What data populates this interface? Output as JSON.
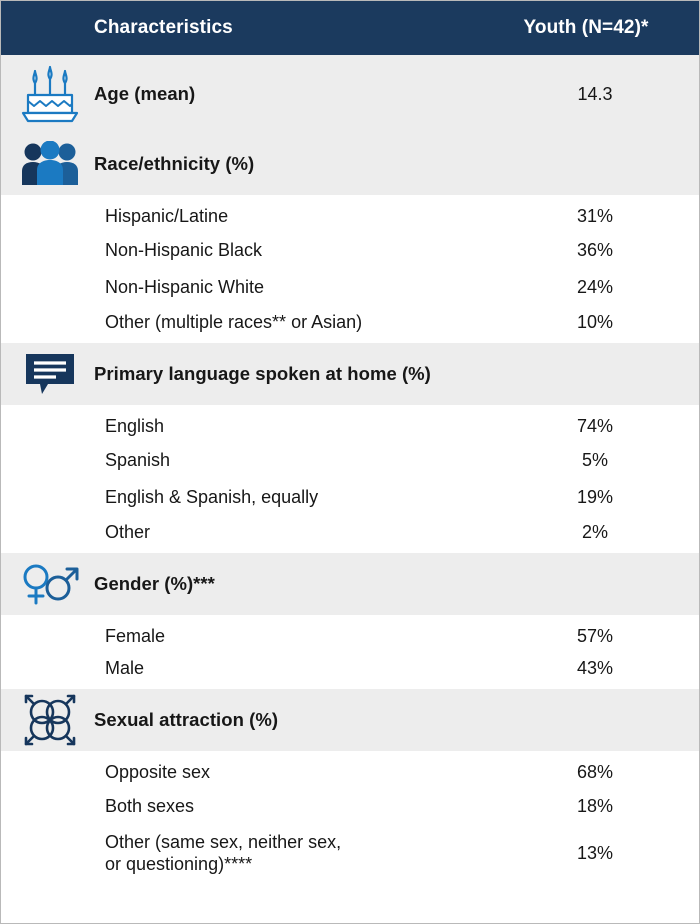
{
  "header": {
    "characteristics_label": "Characteristics",
    "value_label": "Youth (N=42)*"
  },
  "sections": [
    {
      "icon": "birthday-cake-icon",
      "label": "Age (mean)",
      "value": "14.3",
      "rows": []
    },
    {
      "icon": "three-people-icon",
      "label": "Race/ethnicity (%)",
      "value": "",
      "rows": [
        {
          "label": "Hispanic/Latine",
          "value": "31%"
        },
        {
          "label": "Non-Hispanic Black",
          "value": "36%"
        },
        {
          "label": "Non-Hispanic White",
          "value": "24%"
        },
        {
          "label": "Other (multiple races** or Asian)",
          "value": "10%"
        }
      ]
    },
    {
      "icon": "speech-bubble-icon",
      "label": "Primary language spoken at home (%)",
      "value": "",
      "rows": [
        {
          "label": "English",
          "value": "74%"
        },
        {
          "label": "Spanish",
          "value": "5%"
        },
        {
          "label": "English & Spanish, equally",
          "value": "19%"
        },
        {
          "label": "Other",
          "value": "2%"
        }
      ]
    },
    {
      "icon": "venus-mars-icon",
      "label": "Gender (%)***",
      "value": "",
      "rows": [
        {
          "label": "Female",
          "value": "57%"
        },
        {
          "label": "Male",
          "value": "43%"
        }
      ]
    },
    {
      "icon": "interlocking-circles-icon",
      "label": "Sexual attraction (%)",
      "value": "",
      "rows": [
        {
          "label": "Opposite sex",
          "value": "68%"
        },
        {
          "label": "Both sexes",
          "value": "18%"
        },
        {
          "label": "Other (same sex, neither sex, or questioning)****",
          "value": "13%"
        }
      ]
    }
  ],
  "colors": {
    "header_bg": "#1b3a5e",
    "section_bg": "#ededed",
    "row_bg": "#ffffff",
    "icon_navy": "#16365c",
    "icon_blue": "#1b7ac2",
    "icon_mid_blue": "#1c5f99",
    "text": "#171717",
    "border": "#b9b9b9"
  }
}
